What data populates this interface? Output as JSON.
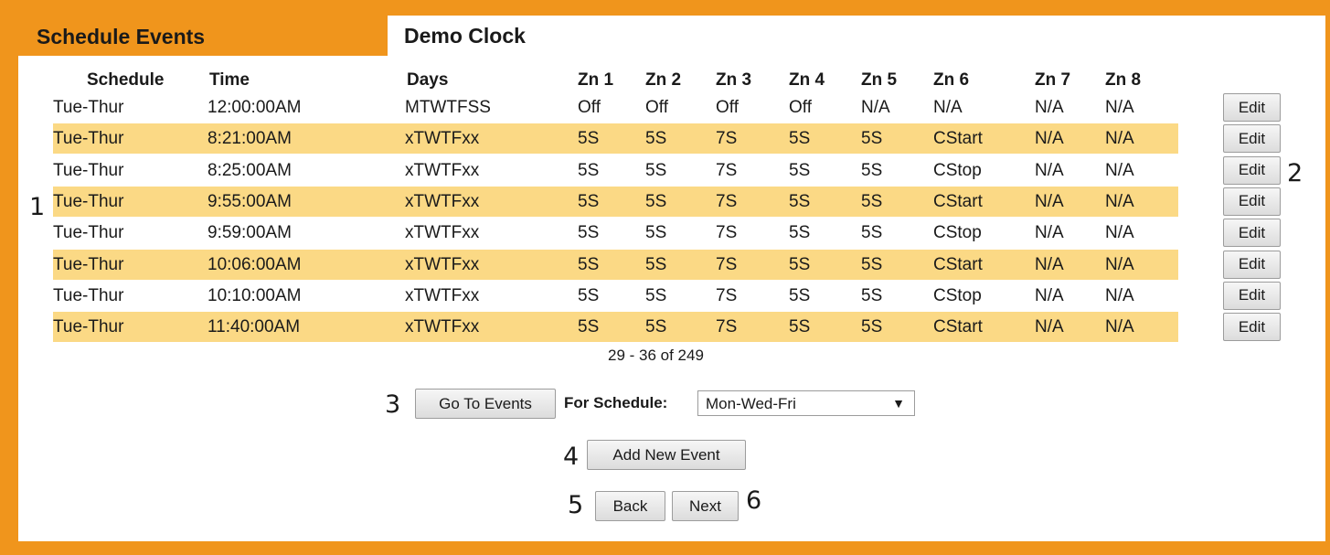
{
  "tabs": {
    "active_label": "Schedule Events",
    "title": "Demo Clock"
  },
  "columns": [
    "Schedule",
    "Time",
    "Days",
    "Zn 1",
    "Zn 2",
    "Zn 3",
    "Zn 4",
    "Zn 5",
    "Zn 6",
    "Zn 7",
    "Zn 8"
  ],
  "rows": [
    {
      "cells": [
        "Tue-Thur",
        "12:00:00AM",
        "MTWTFSS",
        "Off",
        "Off",
        "Off",
        "Off",
        "N/A",
        "N/A",
        "N/A",
        "N/A"
      ],
      "edit": "Edit"
    },
    {
      "cells": [
        "Tue-Thur",
        "8:21:00AM",
        "xTWTFxx",
        "5S",
        "5S",
        "7S",
        "5S",
        "5S",
        "CStart",
        "N/A",
        "N/A"
      ],
      "edit": "Edit"
    },
    {
      "cells": [
        "Tue-Thur",
        "8:25:00AM",
        "xTWTFxx",
        "5S",
        "5S",
        "7S",
        "5S",
        "5S",
        "CStop",
        "N/A",
        "N/A"
      ],
      "edit": "Edit"
    },
    {
      "cells": [
        "Tue-Thur",
        "9:55:00AM",
        "xTWTFxx",
        "5S",
        "5S",
        "7S",
        "5S",
        "5S",
        "CStart",
        "N/A",
        "N/A"
      ],
      "edit": "Edit"
    },
    {
      "cells": [
        "Tue-Thur",
        "9:59:00AM",
        "xTWTFxx",
        "5S",
        "5S",
        "7S",
        "5S",
        "5S",
        "CStop",
        "N/A",
        "N/A"
      ],
      "edit": "Edit"
    },
    {
      "cells": [
        "Tue-Thur",
        "10:06:00AM",
        "xTWTFxx",
        "5S",
        "5S",
        "7S",
        "5S",
        "5S",
        "CStart",
        "N/A",
        "N/A"
      ],
      "edit": "Edit"
    },
    {
      "cells": [
        "Tue-Thur",
        "10:10:00AM",
        "xTWTFxx",
        "5S",
        "5S",
        "7S",
        "5S",
        "5S",
        "CStop",
        "N/A",
        "N/A"
      ],
      "edit": "Edit"
    },
    {
      "cells": [
        "Tue-Thur",
        "11:40:00AM",
        "xTWTFxx",
        "5S",
        "5S",
        "7S",
        "5S",
        "5S",
        "CStart",
        "N/A",
        "N/A"
      ],
      "edit": "Edit"
    }
  ],
  "pagination": {
    "range": "29 - 36 of 249"
  },
  "controls": {
    "go_to_events": "Go To Events",
    "for_schedule_label": "For Schedule:",
    "schedule_select_value": "Mon-Wed-Fri",
    "add_new_event": "Add New Event",
    "back": "Back",
    "next": "Next"
  },
  "annotations": {
    "a1": "1",
    "a2": "2",
    "a3": "3",
    "a4": "4",
    "a5": "5",
    "a6": "6"
  },
  "colors": {
    "frame": "#f0951c",
    "row_highlight": "#fbd985"
  }
}
